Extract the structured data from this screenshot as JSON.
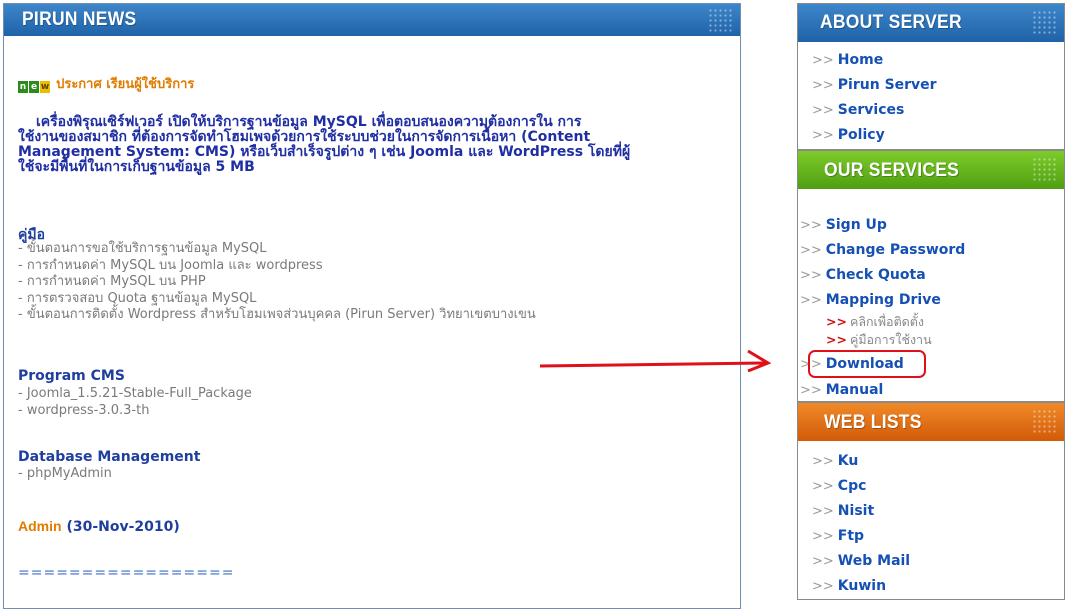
{
  "news": {
    "title": "PIRUN NEWS",
    "announce_badge": "new",
    "announce": "ประกาศ เรียนผู้ใช้บริการ",
    "paragraph": [
      "เครื่องพิรุณเซิร์ฟเวอร์ เปิดให้บริการฐานข้อมูล MySQL เพื่อตอบสนองความต้องการใน การ",
      "ใช้งานของสมาชิก ที่ต้องการจัดทำโฮมเพจด้วยการใช้ระบบช่วยในการจัดการเนื้อหา (Content",
      "Management System: CMS) หรือเว็บสำเร็จรูปต่าง ๆ เช่น Joomla และ WordPress โดยที่ผู้",
      "ใช้จะมีพื้นที่ในการเก็บฐานข้อมูล 5 MB"
    ],
    "manual_heading": "คู่มือ",
    "manual_items": [
      "- ขั้นตอนการขอใช้บริการฐานข้อมูล MySQL",
      "- การกำหนดค่า MySQL บน Joomla และ wordpress",
      "- การกำหนดค่า MySQL บน PHP",
      "- การตรวจสอบ Quota ฐานข้อมูล MySQL",
      "- ขั้นตอนการติดตั้ง Wordpress สำหรับโฮมเพจส่วนบุคคล (Pirun Server) วิทยาเขตบางเขน"
    ],
    "cms_heading": "Program CMS",
    "cms_items": [
      "- Joomla_1.5.21-Stable-Full_Package",
      "- wordpress-3.0.3-th"
    ],
    "db_heading": "Database Management",
    "db_items": [
      "- phpMyAdmin"
    ],
    "admin_name": "Admin",
    "admin_date": "(30-Nov-2010)",
    "separator": "================="
  },
  "about": {
    "title": "ABOUT SERVER",
    "items": [
      "Home",
      "Pirun Server",
      "Services",
      "Policy"
    ]
  },
  "services": {
    "title": "OUR SERVICES",
    "items": [
      "Sign Up",
      "Change Password",
      "Check Quota",
      "Mapping Drive"
    ],
    "sub_items": [
      "คลิกเพื่อติดตั้ง",
      "คู่มือการใช้งาน"
    ],
    "download": "Download",
    "manual": "Manual"
  },
  "weblists": {
    "title": "WEB LISTS",
    "items": [
      "Ku",
      "Cpc",
      "Nisit",
      "Ftp",
      "Web Mail",
      "Kuwin"
    ]
  },
  "bullet": ">>",
  "sub_bullet": ">>",
  "colors": {
    "accent_red": "#e0101a",
    "link_blue": "#1550b5",
    "header_blue": "#2a70b8",
    "header_green": "#5fae18",
    "header_orange": "#e2701a"
  }
}
